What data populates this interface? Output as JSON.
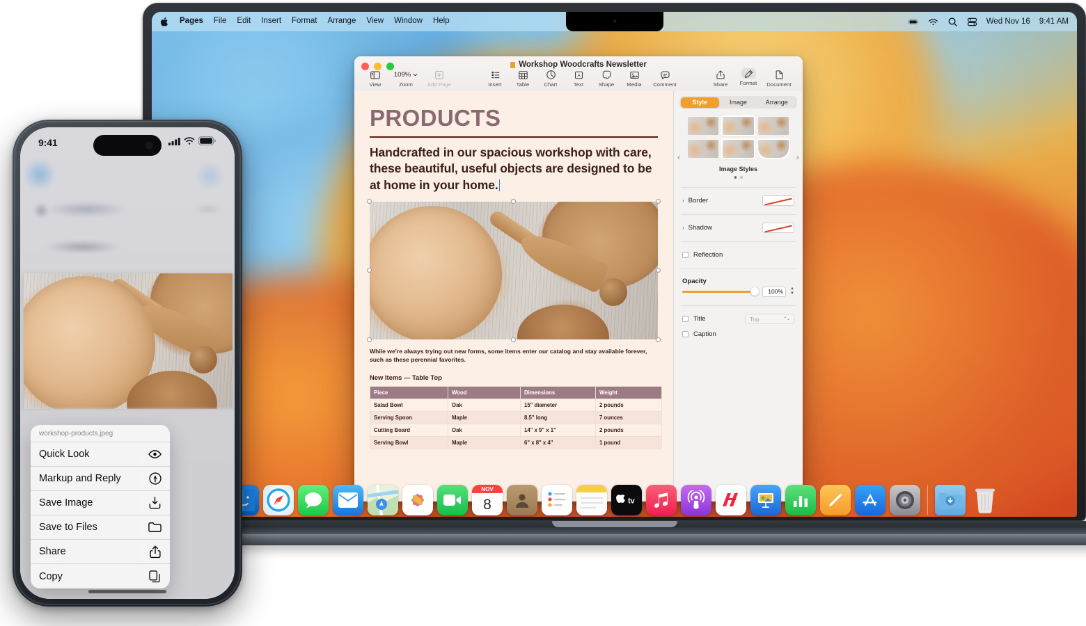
{
  "macos": {
    "menubar": {
      "apple_icon": "apple-logo-icon",
      "items": [
        {
          "label": "Pages",
          "bold": true
        },
        {
          "label": "File",
          "bold": false
        },
        {
          "label": "Edit",
          "bold": false
        },
        {
          "label": "Insert",
          "bold": false
        },
        {
          "label": "Format",
          "bold": false
        },
        {
          "label": "Arrange",
          "bold": false
        },
        {
          "label": "View",
          "bold": false
        },
        {
          "label": "Window",
          "bold": false
        },
        {
          "label": "Help",
          "bold": false
        }
      ],
      "status_icons": [
        "battery-icon",
        "wifi-icon",
        "search-icon",
        "control-center-icon"
      ],
      "date": "Wed Nov 16",
      "time": "9:41 AM"
    },
    "dock": {
      "items": [
        {
          "name": "finder",
          "label": "Finder"
        },
        {
          "name": "safari",
          "label": "Safari"
        },
        {
          "name": "messages",
          "label": "Messages"
        },
        {
          "name": "mail",
          "label": "Mail"
        },
        {
          "name": "maps",
          "label": "Maps"
        },
        {
          "name": "photos",
          "label": "Photos"
        },
        {
          "name": "facetime",
          "label": "FaceTime"
        },
        {
          "name": "calendar",
          "label": "Calendar"
        },
        {
          "name": "contacts",
          "label": "Contacts"
        },
        {
          "name": "reminders",
          "label": "Reminders"
        },
        {
          "name": "notes",
          "label": "Notes"
        },
        {
          "name": "tv",
          "label": "TV"
        },
        {
          "name": "music",
          "label": "Music"
        },
        {
          "name": "podcasts",
          "label": "Podcasts"
        },
        {
          "name": "news",
          "label": "News"
        },
        {
          "name": "keynote",
          "label": "Keynote"
        },
        {
          "name": "numbers",
          "label": "Numbers"
        },
        {
          "name": "pages",
          "label": "Pages"
        },
        {
          "name": "app-store",
          "label": "App Store"
        },
        {
          "name": "system-settings",
          "label": "System Settings"
        },
        {
          "name": "downloads",
          "label": "Downloads"
        },
        {
          "name": "trash",
          "label": "Trash"
        }
      ],
      "calendar_month": "NOV",
      "calendar_day": "8"
    }
  },
  "pages_window": {
    "title": "Workshop Woodcrafts Newsletter",
    "traffic_lights": [
      "close",
      "minimize",
      "zoom"
    ],
    "toolbar": {
      "left": [
        {
          "label": "View",
          "icon": "sidebar-icon",
          "dim": false
        },
        {
          "label": "Zoom",
          "icon": "zoom-value",
          "value": "109%",
          "dim": false
        },
        {
          "label": "Add Page",
          "icon": "add-page-icon",
          "dim": true
        }
      ],
      "center": [
        {
          "label": "Insert",
          "icon": "insert-icon"
        },
        {
          "label": "Table",
          "icon": "table-icon"
        },
        {
          "label": "Chart",
          "icon": "chart-icon"
        },
        {
          "label": "Text",
          "icon": "text-icon"
        },
        {
          "label": "Shape",
          "icon": "shape-icon"
        },
        {
          "label": "Media",
          "icon": "media-icon"
        },
        {
          "label": "Comment",
          "icon": "comment-icon"
        }
      ],
      "right": [
        {
          "label": "Share",
          "icon": "share-icon",
          "active": false
        },
        {
          "label": "Format",
          "icon": "format-brush-icon",
          "active": true
        },
        {
          "label": "Document",
          "icon": "document-icon",
          "active": false
        }
      ]
    },
    "document": {
      "heading": "PRODUCTS",
      "lead": "Handcrafted in our spacious workshop with care, these beautiful, useful objects are designed to be at home in your home.",
      "image_alt": "Wooden bowls and carved serving spoons on weathered white painted wood",
      "caption": "While we're always trying out new forms, some items enter our catalog and stay available forever, such as these perennial favorites.",
      "subheading": "New Items — Table Top",
      "table": {
        "headers": [
          "Piece",
          "Wood",
          "Dimensions",
          "Weight"
        ],
        "rows": [
          [
            "Salad Bowl",
            "Oak",
            "15\" diameter",
            "2 pounds"
          ],
          [
            "Serving Spoon",
            "Maple",
            "8.5\" long",
            "7 ounces"
          ],
          [
            "Cutting Board",
            "Oak",
            "14\" x 9\" x 1\"",
            "2 pounds"
          ],
          [
            "Serving Bowl",
            "Maple",
            "6\" x 8\" x 4\"",
            "1 pound"
          ]
        ]
      }
    },
    "inspector": {
      "tabs": [
        {
          "label": "Style",
          "active": true
        },
        {
          "label": "Image",
          "active": false
        },
        {
          "label": "Arrange",
          "active": false
        }
      ],
      "styles_label": "Image Styles",
      "page_dots": 2,
      "active_dot": 1,
      "prev_arrow": "chevron-left-icon",
      "next_arrow": "chevron-right-icon",
      "rows": [
        {
          "label": "Border",
          "type": "disclosure",
          "control": "line-swatch"
        },
        {
          "label": "Shadow",
          "type": "disclosure",
          "control": "line-swatch"
        },
        {
          "label": "Reflection",
          "type": "checkbox",
          "checked": false
        }
      ],
      "opacity": {
        "label": "Opacity",
        "value": "100%",
        "percent": 100
      },
      "title_row": {
        "label": "Title",
        "checked": false,
        "position": "Top"
      },
      "caption_row": {
        "label": "Caption",
        "checked": false
      }
    }
  },
  "iphone": {
    "status": {
      "time": "9:41",
      "icons": [
        "cellular-icon",
        "wifi-icon",
        "battery-icon"
      ]
    },
    "context_menu": {
      "filename": "workshop-products.jpeg",
      "items": [
        {
          "label": "Quick Look",
          "icon": "eye-icon"
        },
        {
          "label": "Markup and Reply",
          "icon": "markup-pen-icon"
        },
        {
          "label": "Save Image",
          "icon": "save-download-icon"
        },
        {
          "label": "Save to Files",
          "icon": "folder-icon"
        },
        {
          "label": "Share",
          "icon": "share-icon"
        },
        {
          "label": "Copy",
          "icon": "copy-icon"
        }
      ]
    }
  },
  "colors": {
    "accent_orange": "#f0a02a",
    "doc_paper": "#fcefe5",
    "doc_heading": "#8a6a72",
    "doc_text": "#3b2018",
    "table_header": "#9d7b84",
    "menubar": "#bade f3"
  }
}
